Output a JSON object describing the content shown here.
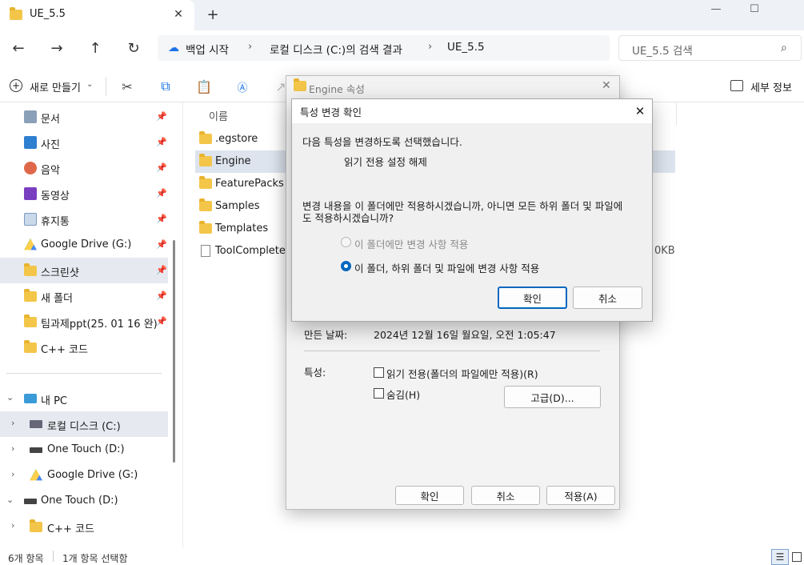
{
  "window": {
    "tab_title": "UE_5.5",
    "new_tab": "+",
    "minimize": "—",
    "maximize": "☐"
  },
  "nav": {
    "back": "←",
    "forward": "→",
    "up": "↑",
    "refresh": "↻",
    "breadcrumb": [
      "백업 시작",
      "로컬 디스크 (C:)의 검색 결과",
      "UE_5.5"
    ],
    "search_placeholder": "UE_5.5 검색"
  },
  "toolbar": {
    "new_label": "새로 만들기",
    "details_label": "세부 정보"
  },
  "sidebar": {
    "quick": [
      {
        "label": "문서",
        "icon": "document-icon"
      },
      {
        "label": "사진",
        "icon": "pictures-icon"
      },
      {
        "label": "음악",
        "icon": "music-icon"
      },
      {
        "label": "동영상",
        "icon": "video-icon"
      },
      {
        "label": "휴지통",
        "icon": "recycle-bin-icon"
      },
      {
        "label": "Google Drive (G:)",
        "icon": "google-drive-icon"
      },
      {
        "label": "스크린샷",
        "icon": "folder-icon"
      },
      {
        "label": "새 폴더",
        "icon": "folder-icon"
      },
      {
        "label": "팀과제ppt(25. 01 16 완)",
        "icon": "folder-icon"
      },
      {
        "label": "C++ 코드",
        "icon": "folder-icon"
      }
    ],
    "tree": [
      {
        "label": "내 PC"
      },
      {
        "label": "로컬 디스크 (C:)"
      },
      {
        "label": "One Touch (D:)"
      },
      {
        "label": "Google Drive (G:)"
      },
      {
        "label": "One Touch (D:)"
      },
      {
        "label": "C++ 코드"
      }
    ]
  },
  "files": {
    "header_name": "이름",
    "items": [
      ".egstore",
      "Engine",
      "FeaturePacks",
      "Samples",
      "Templates",
      "ToolComplete"
    ],
    "size_fragment": "0KB"
  },
  "status": {
    "count": "6개 항목",
    "selected": "1개 항목 선택함"
  },
  "props_dialog": {
    "title": "Engine 속성",
    "created_label": "만든 날짜:",
    "created_value": "2024년 12월 16일 월요일, 오전 1:05:47",
    "attr_label": "특성:",
    "readonly_label": "읽기 전용(폴더의 파일에만 적용)(R)",
    "hidden_label": "숨김(H)",
    "advanced_button": "고급(D)...",
    "ok": "확인",
    "cancel": "취소",
    "apply": "적용(A)"
  },
  "confirm_dialog": {
    "title": "특성 변경 확인",
    "line1": "다음 특성을 변경하도록 선택했습니다.",
    "change": "읽기 전용 설정 해제",
    "question_line1": "변경 내용을 이 폴더에만 적용하시겠습니까, 아니면 모든 하위 폴더 및 파일에",
    "question_line2": "도 적용하시겠습니까?",
    "option1": "이 폴더에만 변경 사항 적용",
    "option2": "이 폴더, 하위 폴더 및 파일에 변경 사항 적용",
    "ok": "확인",
    "cancel": "취소",
    "close": "✕"
  },
  "colors": {
    "accent": "#0067c0",
    "folder": "#f3c64a"
  }
}
